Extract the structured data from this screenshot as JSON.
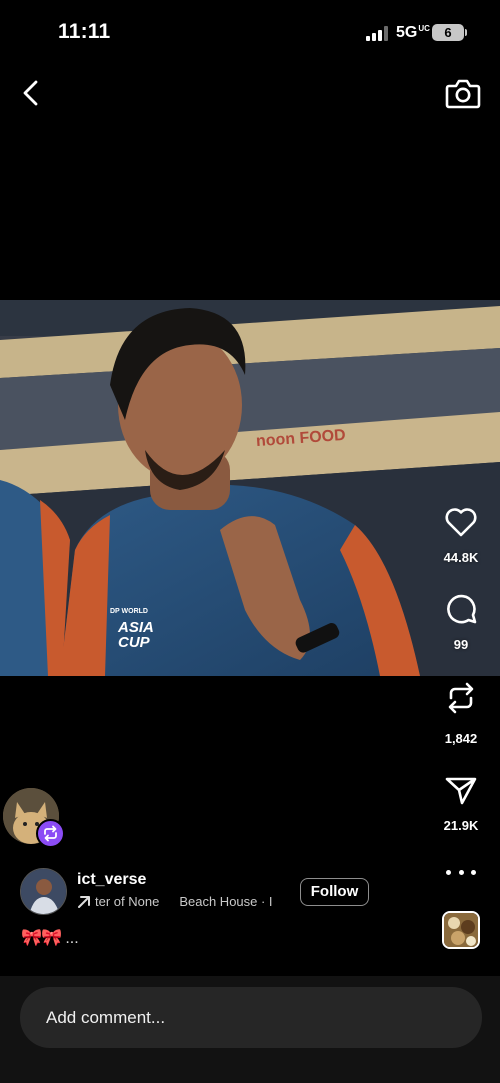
{
  "status": {
    "time": "11:11",
    "network": "5G",
    "network_sup": "UC",
    "battery": "6"
  },
  "video": {
    "banner_text": "noon FOOD",
    "jersey_sponsor": "DP WORLD",
    "jersey_event": "ASIA CUP"
  },
  "actions": {
    "likes": "44.8K",
    "comments": "99",
    "reposts": "1,842",
    "shares": "21.9K"
  },
  "post": {
    "username": "ict_verse",
    "audio_left": "ter of None",
    "audio_right": "Beach House · I",
    "follow_label": "Follow",
    "caption_emoji": "🎀🎀",
    "caption_more": "..."
  },
  "comment": {
    "placeholder": "Add comment..."
  },
  "colors": {
    "repost_badge": "#8b4cf5",
    "comment_bg": "#262626"
  },
  "icons": [
    "chevron-left-icon",
    "camera-icon",
    "heart-icon",
    "comment-icon",
    "repost-icon",
    "send-icon",
    "more-icon"
  ]
}
